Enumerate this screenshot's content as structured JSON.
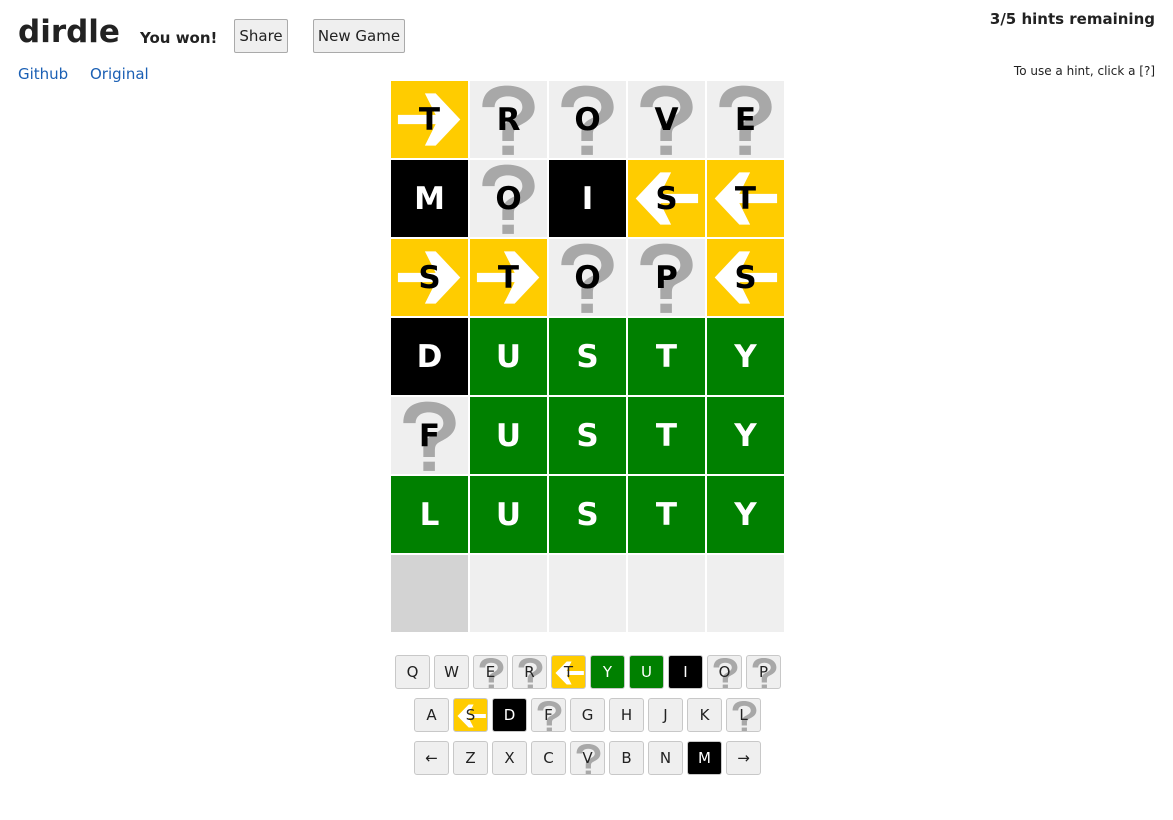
{
  "header": {
    "app_title": "dirdle",
    "status_text": "You won!",
    "share_label": "Share",
    "new_game_label": "New Game",
    "github_link": "Github",
    "original_link": "Original",
    "hints_remaining": "3/5 hints remaining",
    "hint_instructions": "To use a hint, click a [?]"
  },
  "colors": {
    "yellow": "#ffcc00",
    "green": "#008000",
    "black": "#000000",
    "unknown": "#efefef",
    "empty_selected": "#d3d3d3",
    "question_mark": "#a8a8a8"
  },
  "board": {
    "rows": [
      [
        {
          "letter": "T",
          "state": "yellow",
          "dir": "right"
        },
        {
          "letter": "R",
          "state": "unknown"
        },
        {
          "letter": "O",
          "state": "unknown"
        },
        {
          "letter": "V",
          "state": "unknown"
        },
        {
          "letter": "E",
          "state": "unknown"
        }
      ],
      [
        {
          "letter": "M",
          "state": "black"
        },
        {
          "letter": "O",
          "state": "unknown"
        },
        {
          "letter": "I",
          "state": "black"
        },
        {
          "letter": "S",
          "state": "yellow",
          "dir": "left"
        },
        {
          "letter": "T",
          "state": "yellow",
          "dir": "left"
        }
      ],
      [
        {
          "letter": "S",
          "state": "yellow",
          "dir": "right"
        },
        {
          "letter": "T",
          "state": "yellow",
          "dir": "right"
        },
        {
          "letter": "O",
          "state": "unknown"
        },
        {
          "letter": "P",
          "state": "unknown"
        },
        {
          "letter": "S",
          "state": "yellow",
          "dir": "left"
        }
      ],
      [
        {
          "letter": "D",
          "state": "black"
        },
        {
          "letter": "U",
          "state": "green"
        },
        {
          "letter": "S",
          "state": "green"
        },
        {
          "letter": "T",
          "state": "green"
        },
        {
          "letter": "Y",
          "state": "green"
        }
      ],
      [
        {
          "letter": "F",
          "state": "unknown"
        },
        {
          "letter": "U",
          "state": "green"
        },
        {
          "letter": "S",
          "state": "green"
        },
        {
          "letter": "T",
          "state": "green"
        },
        {
          "letter": "Y",
          "state": "green"
        }
      ],
      [
        {
          "letter": "L",
          "state": "green"
        },
        {
          "letter": "U",
          "state": "green"
        },
        {
          "letter": "S",
          "state": "green"
        },
        {
          "letter": "T",
          "state": "green"
        },
        {
          "letter": "Y",
          "state": "green"
        }
      ],
      [
        {
          "letter": "",
          "state": "empty-selected"
        },
        {
          "letter": "",
          "state": "empty"
        },
        {
          "letter": "",
          "state": "empty"
        },
        {
          "letter": "",
          "state": "empty"
        },
        {
          "letter": "",
          "state": "empty"
        }
      ]
    ]
  },
  "keyboard": {
    "rows": [
      [
        {
          "label": "Q",
          "state": "plain"
        },
        {
          "label": "W",
          "state": "plain"
        },
        {
          "label": "E",
          "state": "unknown"
        },
        {
          "label": "R",
          "state": "unknown"
        },
        {
          "label": "T",
          "state": "yellow",
          "dir": "left"
        },
        {
          "label": "Y",
          "state": "green"
        },
        {
          "label": "U",
          "state": "green"
        },
        {
          "label": "I",
          "state": "black"
        },
        {
          "label": "O",
          "state": "unknown"
        },
        {
          "label": "P",
          "state": "unknown"
        }
      ],
      [
        {
          "label": "A",
          "state": "plain"
        },
        {
          "label": "S",
          "state": "yellow",
          "dir": "left"
        },
        {
          "label": "D",
          "state": "black"
        },
        {
          "label": "F",
          "state": "unknown"
        },
        {
          "label": "G",
          "state": "plain"
        },
        {
          "label": "H",
          "state": "plain"
        },
        {
          "label": "J",
          "state": "plain"
        },
        {
          "label": "K",
          "state": "plain"
        },
        {
          "label": "L",
          "state": "unknown"
        }
      ],
      [
        {
          "label": "←",
          "state": "plain",
          "icon": "backspace-arrow-icon"
        },
        {
          "label": "Z",
          "state": "plain"
        },
        {
          "label": "X",
          "state": "plain"
        },
        {
          "label": "C",
          "state": "plain"
        },
        {
          "label": "V",
          "state": "unknown"
        },
        {
          "label": "B",
          "state": "plain"
        },
        {
          "label": "N",
          "state": "plain"
        },
        {
          "label": "M",
          "state": "black"
        },
        {
          "label": "→",
          "state": "plain",
          "icon": "enter-arrow-icon"
        }
      ]
    ]
  }
}
